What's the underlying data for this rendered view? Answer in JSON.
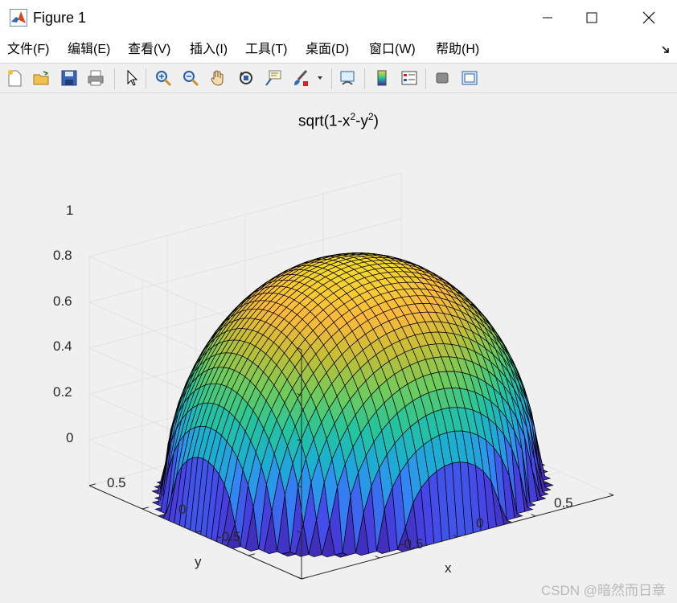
{
  "window": {
    "title": "Figure 1",
    "minimize": "—",
    "maximize": "☐",
    "close": "✕"
  },
  "menu": [
    "文件(F)",
    "编辑(E)",
    "查看(V)",
    "插入(I)",
    "工具(T)",
    "桌面(D)",
    "窗口(W)",
    "帮助(H)"
  ],
  "toolbar": {
    "buttons": [
      "new-figure-icon",
      "open-file-icon",
      "save-icon",
      "print-icon",
      "edit-plot-arrow-icon",
      "zoom-in-icon",
      "zoom-out-icon",
      "pan-hand-icon",
      "rotate-3d-icon",
      "data-cursor-icon",
      "brush-icon",
      "brush-dropdown-icon",
      "link-plot-icon",
      "insert-colorbar-icon",
      "insert-legend-icon",
      "hide-plot-tools-icon",
      "show-plot-tools-icon"
    ]
  },
  "plot": {
    "title_base": "sqrt(1-x",
    "title_sup1": "2",
    "title_mid": "-y",
    "title_sup2": "2",
    "title_end": ")",
    "z_ticks": [
      "1",
      "0.8",
      "0.6",
      "0.4",
      "0.2",
      "0"
    ],
    "x_ticks": [
      "0.5",
      "0",
      "-0.5"
    ],
    "y_ticks": [
      "0.5",
      "0",
      "-0.5"
    ],
    "xlabel": "x",
    "ylabel": "y",
    "colormap": [
      "#3e26a8",
      "#4743e7",
      "#2f8ef5",
      "#1bb0d0",
      "#25c59c",
      "#6ecb5d",
      "#c0bf35",
      "#fdb93a",
      "#f5d92b"
    ]
  },
  "watermark": "CSDN @暗然而日章"
}
